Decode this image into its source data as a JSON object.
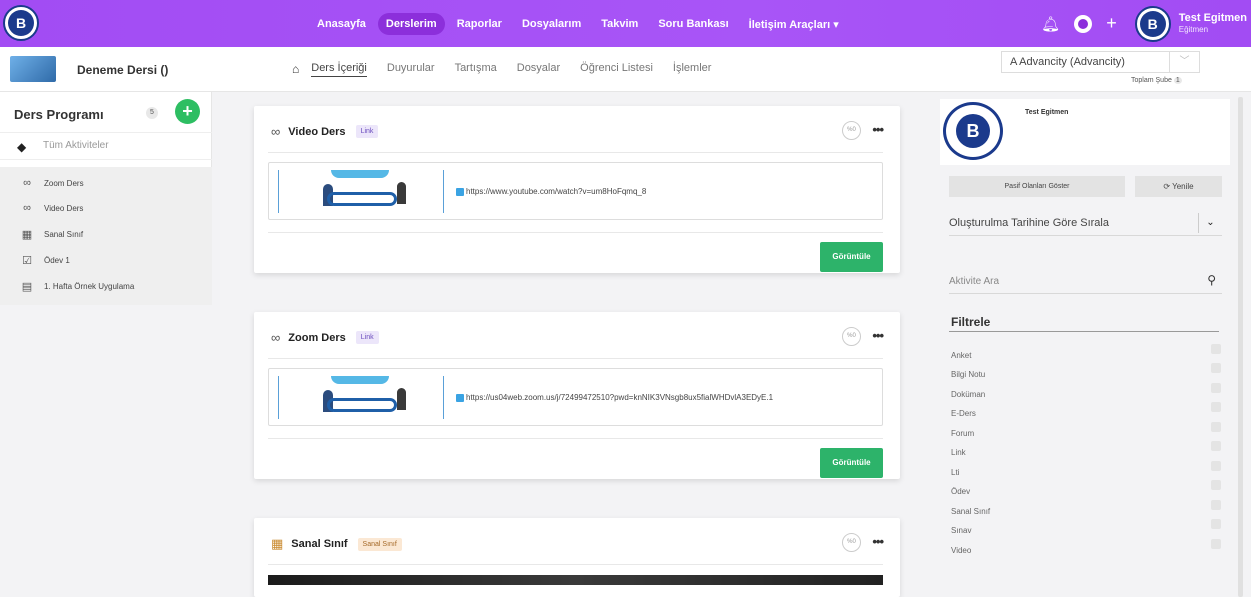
{
  "topbar": {
    "nav": [
      "Anasayfa",
      "Derslerim",
      "Raporlar",
      "Dosyalarım",
      "Takvim",
      "Soru Bankası",
      "İletişim Araçları ▾"
    ],
    "user_name": "Test Egitmen",
    "user_role": "Eğitmen"
  },
  "subbar": {
    "course_title": "Deneme Dersi ()",
    "tabs": [
      "Ders İçeriği",
      "Duyurular",
      "Tartışma",
      "Dosyalar",
      "Öğrenci Listesi",
      "İşlemler"
    ],
    "branch_value": "A Advancity (Advancity)",
    "branch_count_label": "Toplam Şube",
    "branch_count": "1"
  },
  "sidebar": {
    "title": "Ders Programı",
    "count": "5",
    "all_label": "Tüm Aktiviteler",
    "items": [
      {
        "label": "Zoom Ders",
        "icon": "link-icon"
      },
      {
        "label": "Video Ders",
        "icon": "link-icon"
      },
      {
        "label": "Sanal Sınıf",
        "icon": "classroom-icon"
      },
      {
        "label": "Ödev 1",
        "icon": "assignment-icon"
      },
      {
        "label": "1. Hafta Örnek Uygulama",
        "icon": "document-icon"
      }
    ]
  },
  "cards": [
    {
      "title": "Video Ders",
      "badge": "Link",
      "pct": "%0",
      "url": "https://www.youtube.com/watch?v=um8HoFqmq_8",
      "button": "Görüntüle"
    },
    {
      "title": "Zoom Ders",
      "badge": "Link",
      "pct": "%0",
      "url": "https://us04web.zoom.us/j/72499472510?pwd=knNIK3VNsgb8ux5fialWHDvlA3EDyE.1",
      "button": "Görüntüle"
    },
    {
      "title": "Sanal Sınıf",
      "badge": "Sanal Sınıf",
      "pct": "%0"
    }
  ],
  "right_panel": {
    "user_name": "Test Egitmen",
    "passive_button": "Pasif Olanları Göster",
    "refresh_button": "Yenile",
    "sort_value": "Oluşturulma Tarihine Göre Sırala",
    "search_placeholder": "Aktivite Ara",
    "filter_title": "Filtrele",
    "filters": [
      "Anket",
      "Bilgi Notu",
      "Doküman",
      "E-Ders",
      "Forum",
      "Link",
      "Lti",
      "Ödev",
      "Sanal Sınıf",
      "Sınav",
      "Video"
    ]
  },
  "colors": {
    "accent": "#a855f7",
    "active_nav": "#8c2fdb",
    "success": "#2db36a",
    "add_button": "#2dbe62"
  }
}
